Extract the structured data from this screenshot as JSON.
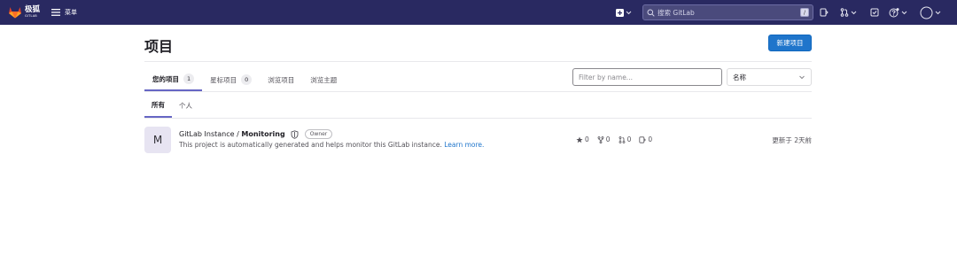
{
  "nav": {
    "logo_cn": "极狐",
    "logo_en": "GITLAB",
    "menu_label": "菜单",
    "search_placeholder": "搜索 GitLab",
    "search_shortcut": "/"
  },
  "page": {
    "title": "项目",
    "new_button": "新建项目"
  },
  "tabs": [
    {
      "label": "您的项目",
      "count": "1"
    },
    {
      "label": "星标项目",
      "count": "0"
    },
    {
      "label": "浏览项目"
    },
    {
      "label": "浏览主题"
    }
  ],
  "filter": {
    "placeholder": "Filter by name..."
  },
  "sort": {
    "selected": "名称"
  },
  "subtabs": [
    "所有",
    "个人"
  ],
  "project": {
    "avatar_letter": "M",
    "namespace": "GitLab Instance / ",
    "name": "Monitoring",
    "role": "Owner",
    "description": "This project is automatically generated and helps monitor this GitLab instance. ",
    "learn_more": "Learn more.",
    "stars": "0",
    "forks": "0",
    "merge_requests": "0",
    "issues": "0",
    "updated": "更新于 2天前"
  },
  "colors": {
    "nav_bg": "#292961",
    "accent": "#1f75cb",
    "tab_underline": "#6666c4"
  }
}
